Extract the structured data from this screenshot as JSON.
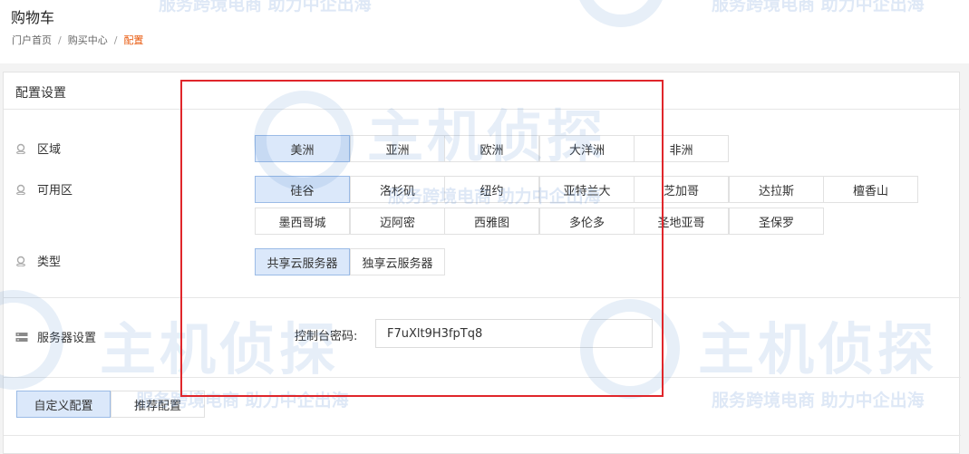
{
  "header": {
    "title": "购物车",
    "breadcrumb": [
      "门户首页",
      "购买中心",
      "配置"
    ],
    "breadcrumb_sep": "/"
  },
  "panel": {
    "title": "配置设置",
    "region": {
      "label": "区域",
      "options": [
        "美洲",
        "亚洲",
        "欧洲",
        "大洋洲",
        "非洲"
      ],
      "selected": "美洲"
    },
    "zone": {
      "label": "可用区",
      "options": [
        "硅谷",
        "洛杉矶",
        "纽约",
        "亚特兰大",
        "芝加哥",
        "达拉斯",
        "檀香山",
        "墨西哥城",
        "迈阿密",
        "西雅图",
        "多伦多",
        "圣地亚哥",
        "圣保罗"
      ],
      "selected": "硅谷"
    },
    "type": {
      "label": "类型",
      "options": [
        "共享云服务器",
        "独享云服务器"
      ],
      "selected": "共享云服务器"
    },
    "server": {
      "label": "服务器设置",
      "password_label": "控制台密码:",
      "password_value": "F7uXlt9H3fpTq8"
    },
    "bottom_tabs": [
      "自定义配置",
      "推荐配置"
    ],
    "bottom_selected": "自定义配置"
  },
  "watermark": {
    "logo_text": "主机侦探",
    "slogan": "服务跨境电商 助力中企出海"
  },
  "colors": {
    "accent_orange": "#e8580c",
    "selected_bg": "#dbe8fa",
    "highlight_red": "#e0262b"
  }
}
